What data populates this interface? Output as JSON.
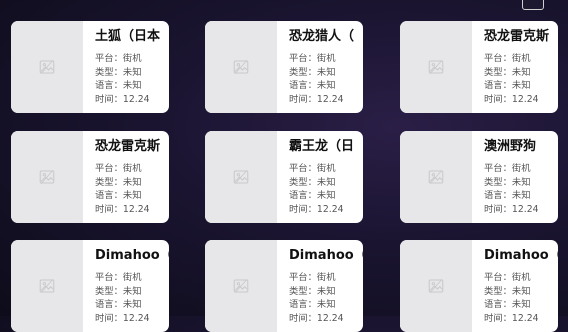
{
  "labels": {
    "platform": "平台：",
    "type": "类型：",
    "language": "语言：",
    "time": "时间："
  },
  "cards": [
    {
      "title": "土狐（日本",
      "platform": "街机",
      "type": "未知",
      "language": "未知",
      "time": "12.24"
    },
    {
      "title": "恐龙猎人（",
      "platform": "街机",
      "type": "未知",
      "language": "未知",
      "time": "12.24"
    },
    {
      "title": "恐龙雷克斯",
      "platform": "街机",
      "type": "未知",
      "language": "未知",
      "time": "12.24"
    },
    {
      "title": "恐龙雷克斯",
      "platform": "街机",
      "type": "未知",
      "language": "未知",
      "time": "12.24"
    },
    {
      "title": "霸王龙（日",
      "platform": "街机",
      "type": "未知",
      "language": "未知",
      "time": "12.24"
    },
    {
      "title": "澳洲野狗",
      "platform": "街机",
      "type": "未知",
      "language": "未知",
      "time": "12.24"
    },
    {
      "title": "Dimahoo（",
      "platform": "街机",
      "type": "未知",
      "language": "未知",
      "time": "12.24"
    },
    {
      "title": "Dimahoo（",
      "platform": "街机",
      "type": "未知",
      "language": "未知",
      "time": "12.24"
    },
    {
      "title": "Dimahoo（",
      "platform": "街机",
      "type": "未知",
      "language": "未知",
      "time": "12.24"
    }
  ]
}
